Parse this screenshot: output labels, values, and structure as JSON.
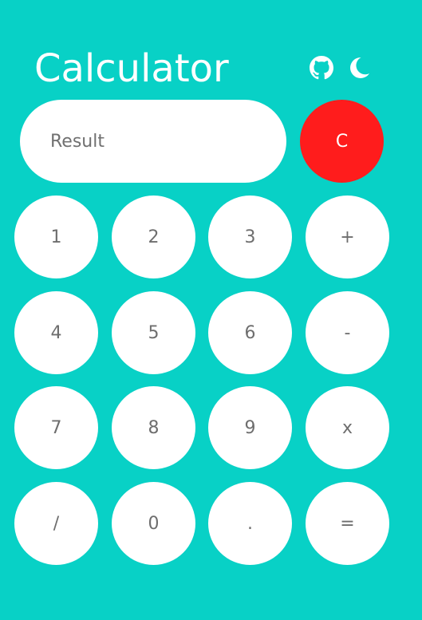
{
  "header": {
    "title": "Calculator",
    "icons": [
      "github-icon",
      "moon-icon"
    ]
  },
  "display": {
    "placeholder": "Result"
  },
  "keys": {
    "clear": "C",
    "one": "1",
    "two": "2",
    "three": "3",
    "plus": "+",
    "four": "4",
    "five": "5",
    "six": "6",
    "minus": "-",
    "seven": "7",
    "eight": "8",
    "nine": "9",
    "multiply": "x",
    "divide": "/",
    "zero": "0",
    "dot": ".",
    "equals": "="
  },
  "colors": {
    "background": "#08d1c6",
    "button": "#ffffff",
    "clear_button": "#ff1c1c",
    "key_text": "#6e6e6e"
  }
}
